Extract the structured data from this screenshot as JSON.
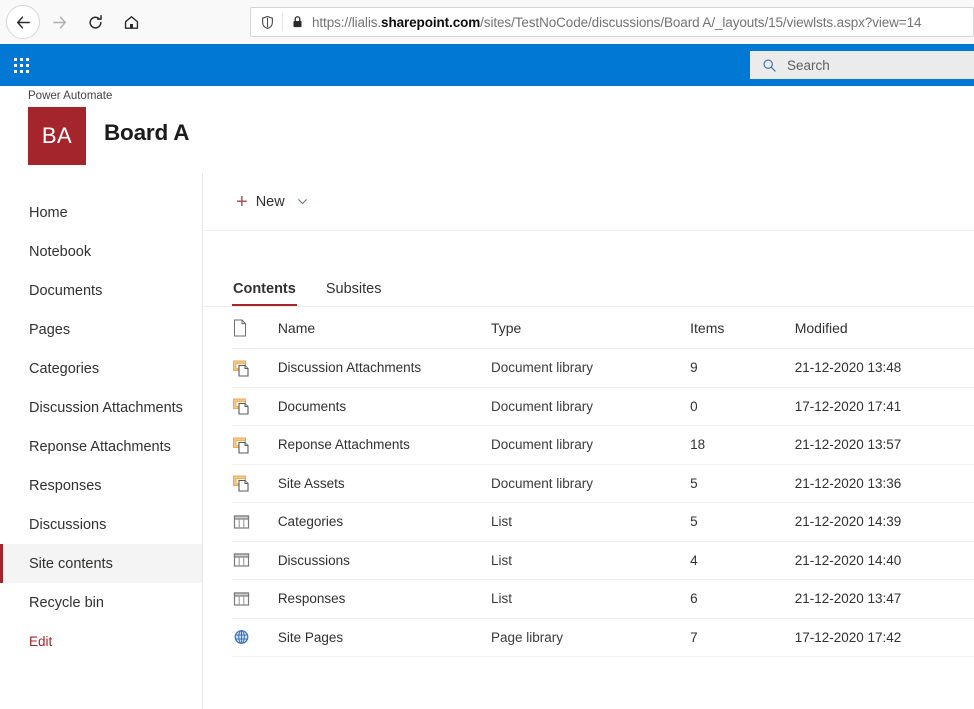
{
  "browser": {
    "back_icon": "arrow-left-icon",
    "forward_icon": "arrow-right-icon",
    "reload_icon": "reload-icon",
    "home_icon": "home-icon",
    "shield_icon": "shield-icon",
    "lock_icon": "lock-icon",
    "url_scheme": "https://lialis.",
    "url_domain": "sharepoint.com",
    "url_path": "/sites/TestNoCode/discussions/Board A/_layouts/15/viewlsts.aspx?view=14",
    "url_full": "https://lialis.sharepoint.com/sites/TestNoCode/discussions/Board A/_layouts/15/viewlsts.aspx?view=14"
  },
  "suite": {
    "waffle_icon": "app-launcher-icon",
    "search_icon": "search-icon",
    "search_placeholder": "Search",
    "bar_color": "#0078d4"
  },
  "site": {
    "hub_name": "Power Automate",
    "logo_initials": "BA",
    "logo_color": "#a4262c",
    "title": "Board A"
  },
  "sidebar": {
    "items": [
      {
        "label": "Home",
        "selected": false
      },
      {
        "label": "Notebook",
        "selected": false
      },
      {
        "label": "Documents",
        "selected": false
      },
      {
        "label": "Pages",
        "selected": false
      },
      {
        "label": "Categories",
        "selected": false
      },
      {
        "label": "Discussion Attachments",
        "selected": false
      },
      {
        "label": "Reponse Attachments",
        "selected": false
      },
      {
        "label": "Responses",
        "selected": false
      },
      {
        "label": "Discussions",
        "selected": false
      },
      {
        "label": "Site contents",
        "selected": true
      },
      {
        "label": "Recycle bin",
        "selected": false
      }
    ],
    "edit_label": "Edit"
  },
  "commandbar": {
    "new_label": "New",
    "new_icon": "plus-icon",
    "new_chevron_icon": "chevron-down-icon"
  },
  "tabs": [
    {
      "label": "Contents",
      "active": true
    },
    {
      "label": "Subsites",
      "active": false
    }
  ],
  "table": {
    "columns": {
      "icon": "document-icon",
      "name": "Name",
      "type": "Type",
      "items": "Items",
      "modified": "Modified"
    },
    "rows": [
      {
        "icon": "document-library-icon",
        "name": "Discussion Attachments",
        "type": "Document library",
        "items": "9",
        "modified": "21-12-2020 13:48"
      },
      {
        "icon": "document-library-icon",
        "name": "Documents",
        "type": "Document library",
        "items": "0",
        "modified": "17-12-2020 17:41"
      },
      {
        "icon": "document-library-icon",
        "name": "Reponse Attachments",
        "type": "Document library",
        "items": "18",
        "modified": "21-12-2020 13:57"
      },
      {
        "icon": "document-library-icon",
        "name": "Site Assets",
        "type": "Document library",
        "items": "5",
        "modified": "21-12-2020 13:36"
      },
      {
        "icon": "list-icon",
        "name": "Categories",
        "type": "List",
        "items": "5",
        "modified": "21-12-2020 14:39"
      },
      {
        "icon": "list-icon",
        "name": "Discussions",
        "type": "List",
        "items": "4",
        "modified": "21-12-2020 14:40"
      },
      {
        "icon": "list-icon",
        "name": "Responses",
        "type": "List",
        "items": "6",
        "modified": "21-12-2020 13:47"
      },
      {
        "icon": "page-library-icon",
        "name": "Site Pages",
        "type": "Page library",
        "items": "7",
        "modified": "17-12-2020 17:42"
      }
    ]
  }
}
